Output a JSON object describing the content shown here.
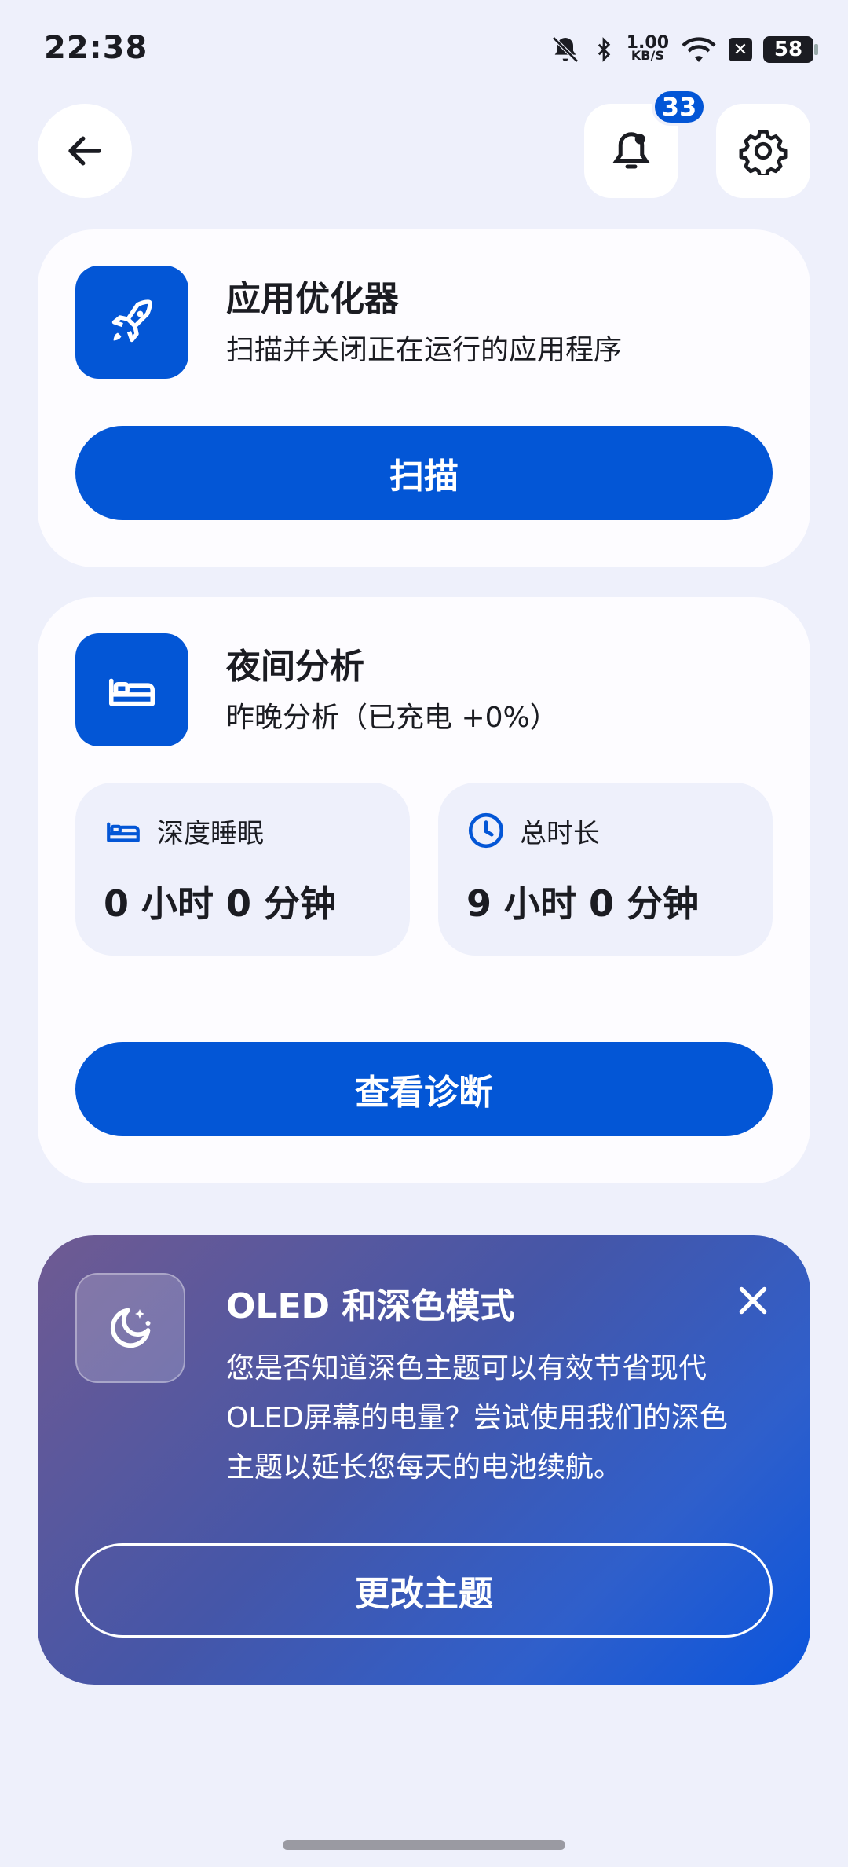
{
  "status_bar": {
    "time": "22:38",
    "net_speed_value": "1.00",
    "net_speed_unit": "KB/S",
    "battery": "58"
  },
  "header": {
    "notification_count": "33"
  },
  "app_optimizer": {
    "title": "应用优化器",
    "subtitle": "扫描并关闭正在运行的应用程序",
    "button": "扫描"
  },
  "night_analysis": {
    "title": "夜间分析",
    "subtitle": "昨晚分析（已充电 +0%）",
    "deep_sleep_label": "深度睡眠",
    "deep_sleep_value": "0 小时 0 分钟",
    "total_label": "总时长",
    "total_value": "9 小时 0 分钟",
    "button": "查看诊断"
  },
  "oled_promo": {
    "title": "OLED 和深色模式",
    "line1": "您是否知道深色主题可以有效节省现代",
    "line2": "OLED屏幕的电量？尝试使用我们的深色",
    "line3": "主题以延长您每天的电池续航。",
    "button": "更改主题"
  },
  "colors": {
    "accent": "#0356d6",
    "background": "#eef0fb",
    "card": "#fdfcff"
  }
}
